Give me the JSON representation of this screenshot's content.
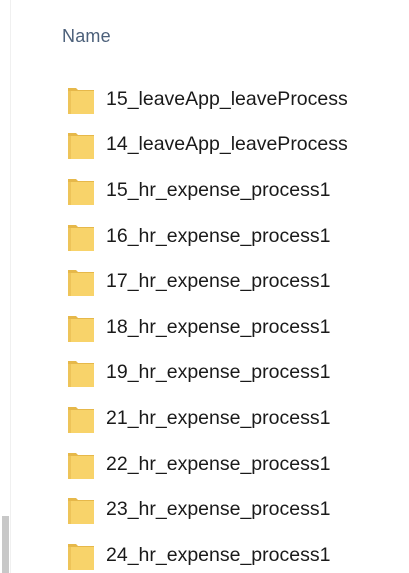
{
  "header": {
    "name_column": "Name"
  },
  "colors": {
    "folder": "#f8d36a",
    "folder_shade": "#e6b84a",
    "header_text": "#4c607a"
  },
  "files": [
    {
      "name": "15_leaveApp_leaveProcess",
      "icon": "folder-icon"
    },
    {
      "name": "14_leaveApp_leaveProcess",
      "icon": "folder-icon"
    },
    {
      "name": "15_hr_expense_process1",
      "icon": "folder-icon"
    },
    {
      "name": "16_hr_expense_process1",
      "icon": "folder-icon"
    },
    {
      "name": "17_hr_expense_process1",
      "icon": "folder-icon"
    },
    {
      "name": "18_hr_expense_process1",
      "icon": "folder-icon"
    },
    {
      "name": "19_hr_expense_process1",
      "icon": "folder-icon"
    },
    {
      "name": "21_hr_expense_process1",
      "icon": "folder-icon"
    },
    {
      "name": "22_hr_expense_process1",
      "icon": "folder-icon"
    },
    {
      "name": "23_hr_expense_process1",
      "icon": "folder-icon"
    },
    {
      "name": "24_hr_expense_process1",
      "icon": "folder-icon"
    }
  ]
}
